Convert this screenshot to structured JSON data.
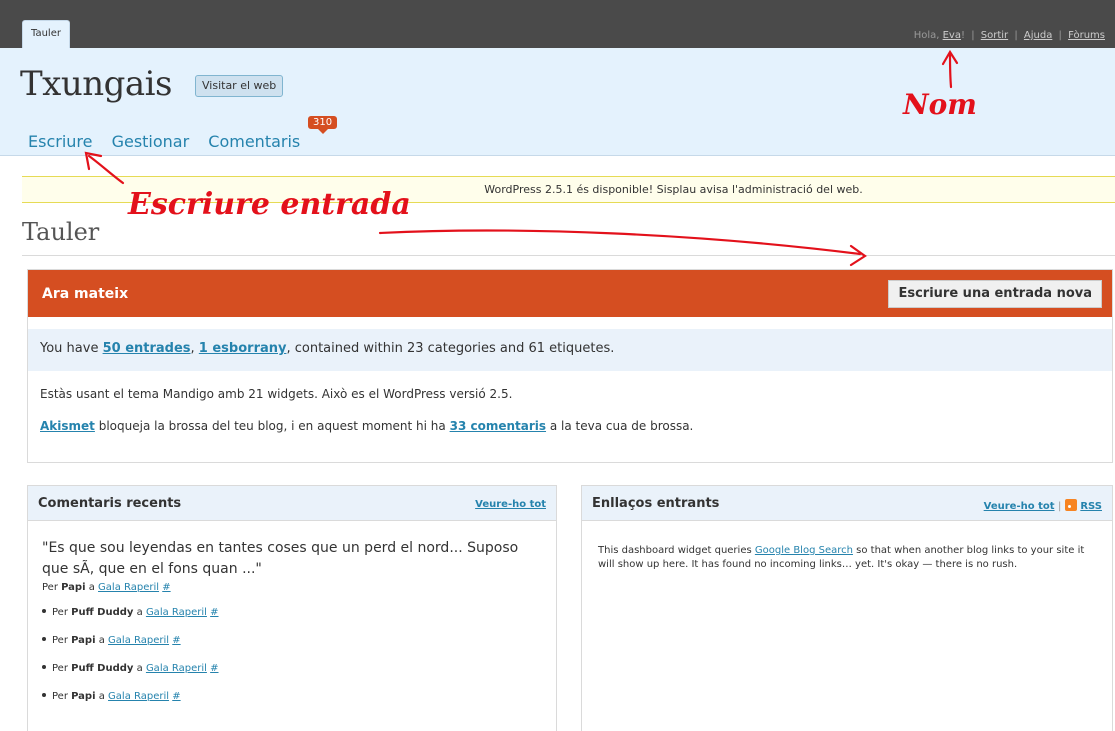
{
  "topbar": {
    "tab": "Tauler",
    "greeting": "Hola,",
    "user": "Eva",
    "greeting_end": "!",
    "links": [
      "Sortir",
      "Ajuda",
      "Fòrums"
    ]
  },
  "header": {
    "site_title": "Txungais",
    "visit_button": "Visitar el web",
    "nav": [
      "Escriure",
      "Gestionar",
      "Comentaris"
    ],
    "comments_badge": "310"
  },
  "update_notice": "WordPress 2.5.1 és disponible! Sisplau avisa l'administració del web.",
  "page_title": "Tauler",
  "right_now": {
    "title": "Ara mateix",
    "button": "Escriure una entrada nova",
    "summary_prefix": "You have",
    "posts_link": "50 entrades",
    "drafts_link": "1 esborrany",
    "summary_suffix": ", contained within 23 categories and 61 etiquetes.",
    "theme_line": "Estàs usant el tema Mandigo amb 21 widgets. Això es el WordPress versió 2.5.",
    "akismet_link": "Akismet",
    "akismet_mid": "bloqueja la brossa del teu blog, i en aquest moment hi ha",
    "spam_link": "33 comentaris",
    "akismet_end": "a la teva cua de brossa."
  },
  "recent_comments": {
    "title": "Comentaris recents",
    "view_all": "Veure-ho tot",
    "quote": "\"Es que sou leyendas en tantes coses que un perd el nord... Suposo que sÃ, que en el fons quan ...\"",
    "first": {
      "per": "Per",
      "author": "Papi",
      "a": "a",
      "post": "Gala Raperil",
      "hash": "#"
    },
    "items": [
      {
        "per": "Per",
        "author": "Puff Duddy",
        "a": "a",
        "post": "Gala Raperil",
        "hash": "#"
      },
      {
        "per": "Per",
        "author": "Papi",
        "a": "a",
        "post": "Gala Raperil",
        "hash": "#"
      },
      {
        "per": "Per",
        "author": "Puff Duddy",
        "a": "a",
        "post": "Gala Raperil",
        "hash": "#"
      },
      {
        "per": "Per",
        "author": "Papi",
        "a": "a",
        "post": "Gala Raperil",
        "hash": "#"
      }
    ]
  },
  "incoming_links": {
    "title": "Enllaços entrants",
    "view_all": "Veure-ho tot",
    "separator": "|",
    "rss": "RSS",
    "text_before": "This dashboard widget queries",
    "blog_search_link": "Google Blog Search",
    "text_after": "so that when another blog links to your site it will show up here. It has found no incoming links… yet. It's okay — there is no rush."
  },
  "annotations": {
    "name_label": "Nom",
    "write_label": "Escriure entrada",
    "color": "#e3111b"
  }
}
